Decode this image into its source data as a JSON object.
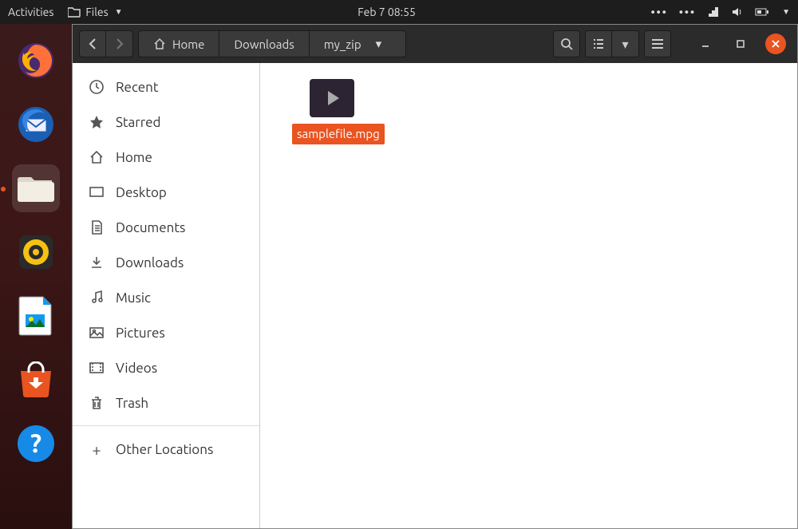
{
  "menubar": {
    "activities": "Activities",
    "app_menu": "Files",
    "datetime": "Feb 7  08:55"
  },
  "titlebar": {
    "path": [
      "Home",
      "Downloads",
      "my_zip"
    ]
  },
  "sidebar": {
    "items": [
      {
        "label": "Recent"
      },
      {
        "label": "Starred"
      },
      {
        "label": "Home"
      },
      {
        "label": "Desktop"
      },
      {
        "label": "Documents"
      },
      {
        "label": "Downloads"
      },
      {
        "label": "Music"
      },
      {
        "label": "Pictures"
      },
      {
        "label": "Videos"
      },
      {
        "label": "Trash"
      }
    ],
    "other_locations": "Other Locations"
  },
  "content": {
    "files": [
      {
        "name": "samplefile.mpg",
        "selected": true
      }
    ]
  },
  "colors": {
    "accent": "#E95420"
  }
}
